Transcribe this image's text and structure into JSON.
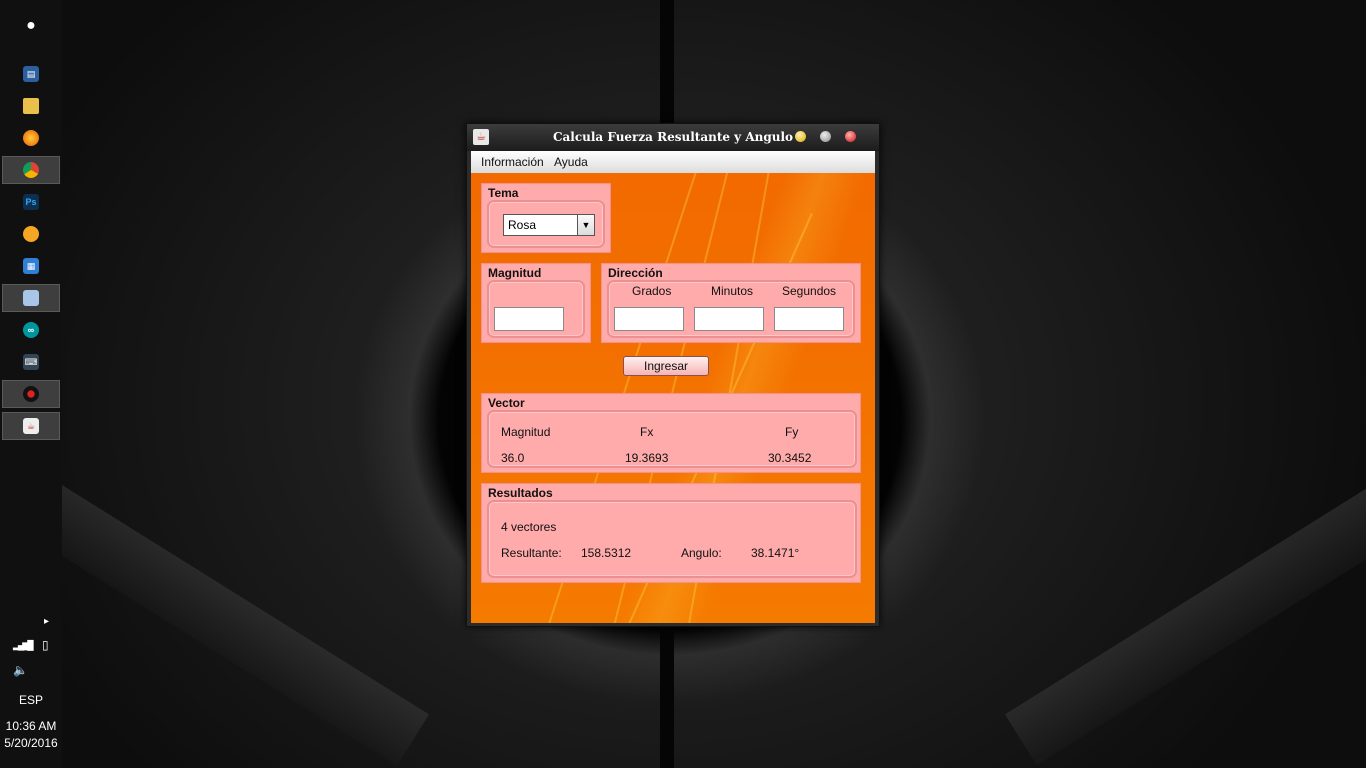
{
  "taskbar": {
    "icons": [
      {
        "name": "apple-icon",
        "glyph": ""
      },
      {
        "name": "monitor-app-icon",
        "glyph": "▤"
      },
      {
        "name": "folder-icon",
        "glyph": "▭"
      },
      {
        "name": "firefox-icon",
        "glyph": "●"
      },
      {
        "name": "chrome-icon",
        "glyph": "◉"
      },
      {
        "name": "photoshop-icon",
        "glyph": "Ps"
      },
      {
        "name": "fl-studio-icon",
        "glyph": "♪"
      },
      {
        "name": "window-app-icon",
        "glyph": "▦"
      },
      {
        "name": "cube-app-icon",
        "glyph": "◈"
      },
      {
        "name": "arduino-icon",
        "glyph": "∞"
      },
      {
        "name": "keyboard-app-icon",
        "glyph": "⌨"
      },
      {
        "name": "media-app-icon",
        "glyph": "◎"
      },
      {
        "name": "java-app-icon",
        "glyph": "☕"
      }
    ],
    "status": {
      "expand": "▸",
      "signal": "▂▄▆█",
      "battery": "▯",
      "volume": "🔈",
      "language": "ESP"
    },
    "clock": {
      "time": "10:36 AM",
      "date": "5/20/2016"
    }
  },
  "window": {
    "title": "Calcula Fuerza Resultante y Angulo",
    "menu": [
      "Información",
      "Ayuda"
    ],
    "tema": {
      "title": "Tema",
      "selected": "Rosa"
    },
    "magnitud": {
      "title": "Magnitud",
      "value": ""
    },
    "direccion": {
      "title": "Dirección",
      "labels": [
        "Grados",
        "Minutos",
        "Segundos"
      ],
      "values": [
        "",
        "",
        ""
      ]
    },
    "ingresar_label": "Ingresar",
    "vector": {
      "title": "Vector",
      "headers": [
        "Magnitud",
        "Fx",
        "Fy"
      ],
      "values": [
        "36.0",
        "19.3693",
        "30.3452"
      ]
    },
    "resultados": {
      "title": "Resultados",
      "count": "4 vectores",
      "resultante_label": "Resultante:",
      "resultante_value": "158.5312",
      "angulo_label": "Angulo:",
      "angulo_value": "38.1471°"
    }
  },
  "colors": {
    "background_orange": "#f26a00",
    "panel_pink": "#ffabab"
  }
}
